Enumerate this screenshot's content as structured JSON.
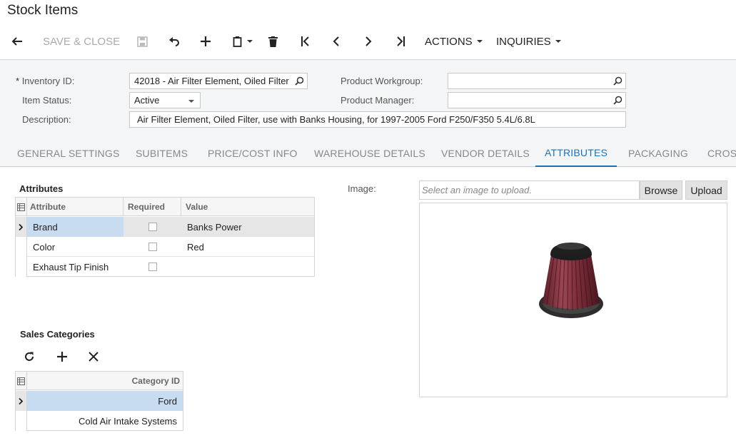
{
  "page": {
    "title": "Stock Items"
  },
  "toolbar": {
    "save_close": "SAVE & CLOSE",
    "actions": "ACTIONS",
    "inquiries": "INQUIRIES",
    "icons": [
      "back-arrow-icon",
      "save-icon",
      "undo-icon",
      "add-icon",
      "copy-paste-icon",
      "delete-icon",
      "first-record-icon",
      "previous-record-icon",
      "next-record-icon",
      "last-record-icon"
    ]
  },
  "form": {
    "inventory_id_label": "Inventory ID:",
    "inventory_id_required": "*",
    "inventory_id_value": "42018 -  Air Filter Element, Oiled Filter",
    "item_status_label": "Item Status:",
    "item_status_value": "Active",
    "description_label": "Description:",
    "description_value": "Air Filter Element, Oiled Filter, use with Banks Housing, for 1997-2005 Ford F250/F350 5.4L/6.8L",
    "product_workgroup_label": "Product Workgroup:",
    "product_workgroup_value": "",
    "product_manager_label": "Product Manager:",
    "product_manager_value": ""
  },
  "tabs": [
    {
      "label": "GENERAL SETTINGS",
      "active": false
    },
    {
      "label": "SUBITEMS",
      "active": false
    },
    {
      "label": "PRICE/COST INFO",
      "active": false
    },
    {
      "label": "WAREHOUSE DETAILS",
      "active": false
    },
    {
      "label": "VENDOR DETAILS",
      "active": false
    },
    {
      "label": "ATTRIBUTES",
      "active": true
    },
    {
      "label": "PACKAGING",
      "active": false
    },
    {
      "label": "CROS",
      "active": false
    }
  ],
  "attributes": {
    "title": "Attributes",
    "columns": [
      "Attribute",
      "Required",
      "Value"
    ],
    "rows": [
      {
        "attribute": "Brand",
        "required": false,
        "value": "Banks Power",
        "selected": true
      },
      {
        "attribute": "Color",
        "required": false,
        "value": "Red",
        "selected": false
      },
      {
        "attribute": "Exhaust Tip Finish",
        "required": false,
        "value": "",
        "selected": false
      }
    ]
  },
  "image": {
    "label": "Image:",
    "placeholder": "Select an image to upload.",
    "browse": "Browse",
    "upload": "Upload"
  },
  "sales_categories": {
    "title": "Sales Categories",
    "column": "Category ID",
    "rows": [
      {
        "category": "Ford",
        "selected": true
      },
      {
        "category": "Cold Air Intake Systems",
        "selected": false
      }
    ]
  },
  "colors": {
    "accent": "#1a73b8",
    "selection": "#c8dcf1"
  }
}
